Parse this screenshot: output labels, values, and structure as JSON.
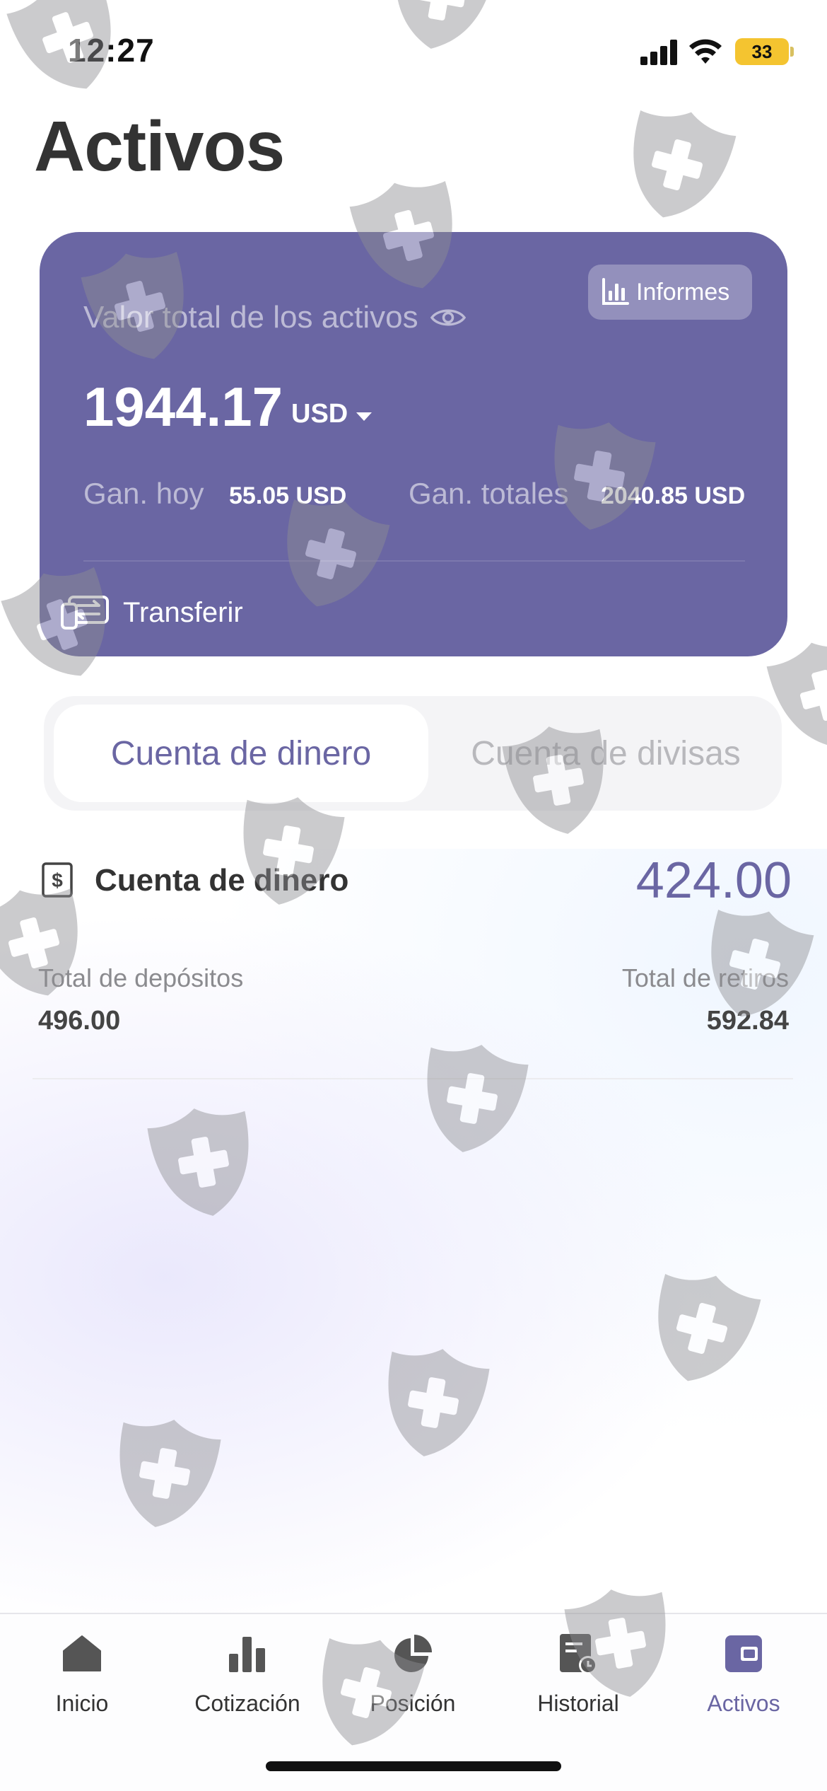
{
  "status_bar": {
    "time": "12:27",
    "battery": "33"
  },
  "page": {
    "title": "Activos"
  },
  "asset_card": {
    "reports_label": "Informes",
    "total_label": "Valor total de los activos",
    "total_value": "1944.17",
    "currency": "USD",
    "today_label": "Gan. hoy",
    "today_value": "55.05 USD",
    "total_gain_label": "Gan. totales",
    "total_gain_value": "2040.85 USD",
    "transfer_label": "Transferir",
    "card_color": "#6a66a3"
  },
  "tabs": [
    {
      "label": "Cuenta de dinero",
      "active": true
    },
    {
      "label": "Cuenta de divisas",
      "active": false
    }
  ],
  "account": {
    "title": "Cuenta de dinero",
    "balance": "424.00",
    "deposits_label": "Total de depósitos",
    "deposits_value": "496.00",
    "withdrawals_label": "Total de retiros",
    "withdrawals_value": "592.84"
  },
  "bottom_nav": {
    "items": [
      {
        "label": "Inicio",
        "icon": "home-icon"
      },
      {
        "label": "Cotización",
        "icon": "bar-chart-icon"
      },
      {
        "label": "Posición",
        "icon": "pie-chart-icon"
      },
      {
        "label": "Historial",
        "icon": "history-icon"
      },
      {
        "label": "Activos",
        "icon": "wallet-icon",
        "active": true
      }
    ]
  },
  "colors": {
    "accent": "#6a66a3",
    "battery": "#f4c430"
  }
}
